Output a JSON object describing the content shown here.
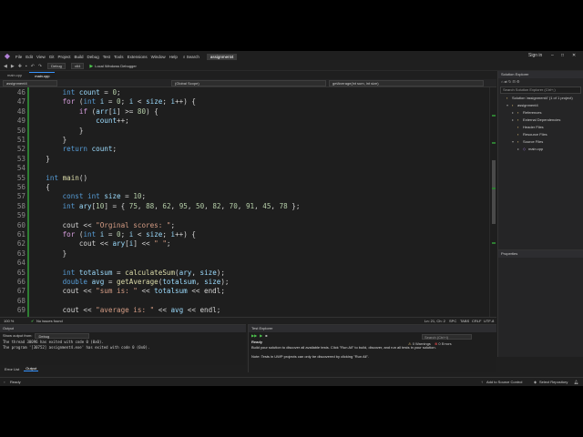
{
  "menu": {
    "items": [
      "File",
      "Edit",
      "View",
      "Git",
      "Project",
      "Build",
      "Debug",
      "Test",
      "Tools",
      "Extensions",
      "Window",
      "Help"
    ],
    "search": "Search",
    "solution_name": "assignment4",
    "sign_in": "Sign in"
  },
  "toolbar": {
    "config": "Debug",
    "platform": "x64",
    "debugger": "Local Windows Debugger"
  },
  "tabs": [
    {
      "label": "main.cpp",
      "active": false
    },
    {
      "label": "main.cpp",
      "active": true
    }
  ],
  "nav": {
    "project": "assignment4",
    "scope": "(Global Scope)",
    "member": "getAverage(int sum, int size)"
  },
  "editor": {
    "lines": [
      {
        "n": "46",
        "t": "        int count = 0;"
      },
      {
        "n": "47",
        "t": "        for (int i = 0; i < size; i++) {"
      },
      {
        "n": "48",
        "t": "            if (arr[i] >= 80) {"
      },
      {
        "n": "49",
        "t": "                count++;"
      },
      {
        "n": "50",
        "t": "            }"
      },
      {
        "n": "51",
        "t": "        }"
      },
      {
        "n": "52",
        "t": "        return count;"
      },
      {
        "n": "53",
        "t": "    }"
      },
      {
        "n": "54",
        "t": ""
      },
      {
        "n": "55",
        "t": "    int main()"
      },
      {
        "n": "56",
        "t": "    {"
      },
      {
        "n": "57",
        "t": "        const int size = 10;"
      },
      {
        "n": "58",
        "t": "        int ary[10] = { 75, 88, 62, 95, 50, 82, 70, 91, 45, 78 };"
      },
      {
        "n": "59",
        "t": ""
      },
      {
        "n": "60",
        "t": "        cout << \"Orginal scores: \";"
      },
      {
        "n": "61",
        "t": "        for (int i = 0; i < size; i++) {"
      },
      {
        "n": "62",
        "t": "            cout << ary[i] << \" \";"
      },
      {
        "n": "63",
        "t": "        }"
      },
      {
        "n": "64",
        "t": ""
      },
      {
        "n": "65",
        "t": "        int totalsum = calculateSum(ary, size);"
      },
      {
        "n": "66",
        "t": "        double avg = getAverage(totalsum, size);"
      },
      {
        "n": "67",
        "t": "        cout << \"sum is: \" << totalsum << endl;"
      },
      {
        "n": "68",
        "t": ""
      },
      {
        "n": "69",
        "t": "        cout << \"average is: \" << avg << endl;"
      }
    ],
    "zoom": "100 %",
    "issues": "No issues found",
    "position": "Ln: 21, Ch: 2",
    "mode": "SPC",
    "tabs": "TABS",
    "line_ending": "CRLF",
    "encoding": "UTF-8"
  },
  "solution_explorer": {
    "title": "Solution Explorer",
    "search_placeholder": "Search Solution Explorer (Ctrl+;)",
    "items": [
      {
        "label": "Solution 'assignment4' (1 of 1 project)",
        "indent": 0,
        "twisty": ""
      },
      {
        "label": "assignment4",
        "indent": 1,
        "twisty": "▾"
      },
      {
        "label": "References",
        "indent": 2,
        "twisty": "▸"
      },
      {
        "label": "External Dependencies",
        "indent": 2,
        "twisty": "▸"
      },
      {
        "label": "Header Files",
        "indent": 2,
        "twisty": ""
      },
      {
        "label": "Resource Files",
        "indent": 2,
        "twisty": ""
      },
      {
        "label": "Source Files",
        "indent": 2,
        "twisty": "▾"
      },
      {
        "label": "main.cpp",
        "indent": 3,
        "twisty": "▸"
      }
    ]
  },
  "properties": {
    "title": "Properties"
  },
  "output": {
    "title": "Output",
    "show_from_label": "Show output from:",
    "show_from_value": "Debug",
    "lines": [
      "The thread 30096 has exited with code 0 (0x0).",
      "The program '[30752] assignment4.exe' has exited with code 0 (0x0)."
    ],
    "tabs": [
      "Error List",
      "Output"
    ]
  },
  "test_explorer": {
    "title": "Test Explorer",
    "search_placeholder": "Search (Ctrl+I)",
    "warnings": "0 Warnings",
    "errors": "0 Errors",
    "state": "Ready",
    "message1": "Build your solution to discover all available tests. Click \"Run All\" to build, discover, and run all tests in your solution.",
    "message2": "Note: Tests in UWP projects can only be discovered by clicking \"Run All\"."
  },
  "statusbar": {
    "ready": "Ready",
    "add_source": "Add to Source Control",
    "select_repo": "Select Repository"
  }
}
